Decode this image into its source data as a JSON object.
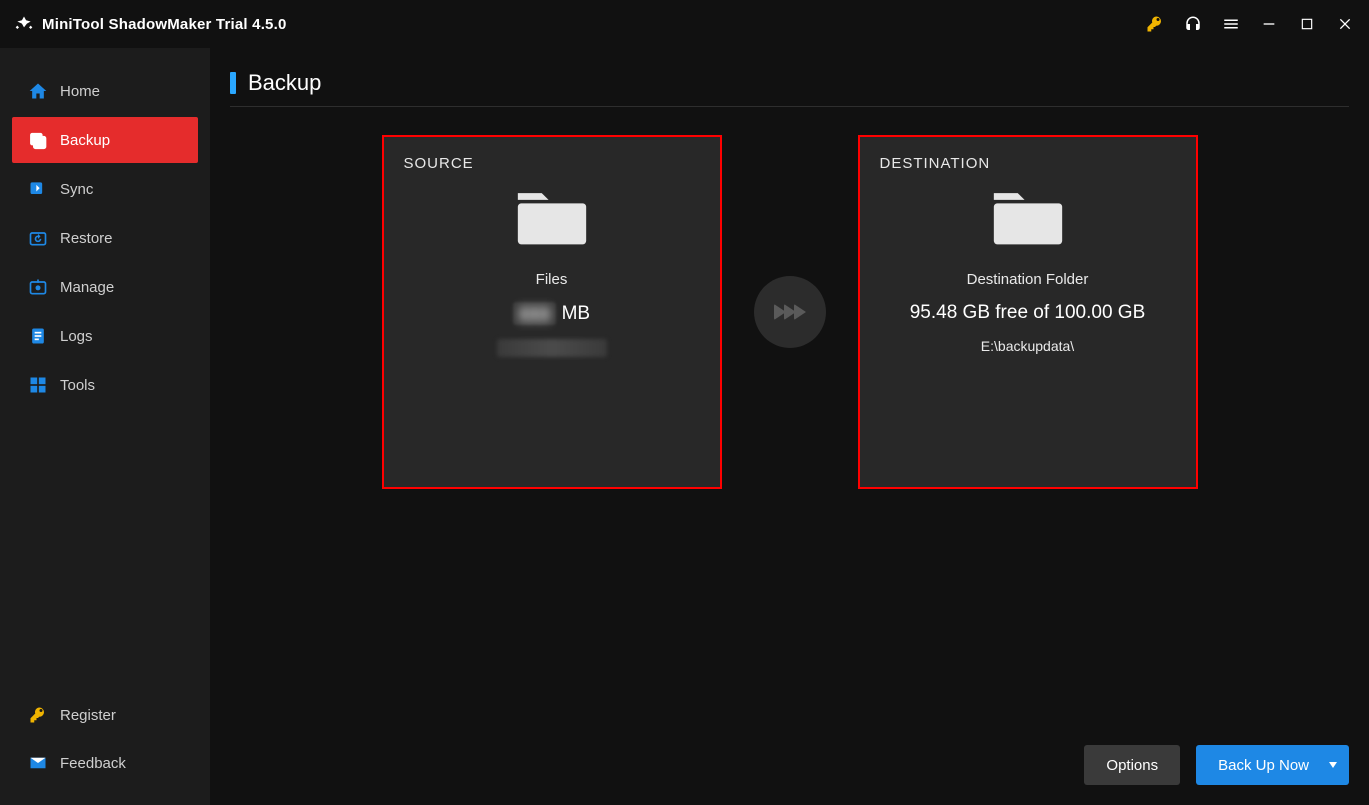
{
  "app": {
    "title": "MiniTool ShadowMaker Trial 4.5.0"
  },
  "titlebar_icons": {
    "key": "key-icon",
    "headset": "headset-icon",
    "menu": "menu-icon",
    "minimize": "minimize-icon",
    "maximize": "maximize-icon",
    "close": "close-icon"
  },
  "sidebar": {
    "items": [
      {
        "id": "home",
        "label": "Home",
        "icon": "home-icon",
        "active": false
      },
      {
        "id": "backup",
        "label": "Backup",
        "icon": "backup-icon",
        "active": true
      },
      {
        "id": "sync",
        "label": "Sync",
        "icon": "sync-icon",
        "active": false
      },
      {
        "id": "restore",
        "label": "Restore",
        "icon": "restore-icon",
        "active": false
      },
      {
        "id": "manage",
        "label": "Manage",
        "icon": "manage-icon",
        "active": false
      },
      {
        "id": "logs",
        "label": "Logs",
        "icon": "logs-icon",
        "active": false
      },
      {
        "id": "tools",
        "label": "Tools",
        "icon": "tools-icon",
        "active": false
      }
    ],
    "bottom": [
      {
        "id": "register",
        "label": "Register",
        "icon": "register-icon"
      },
      {
        "id": "feedback",
        "label": "Feedback",
        "icon": "feedback-icon"
      }
    ]
  },
  "page": {
    "title": "Backup"
  },
  "source": {
    "heading": "SOURCE",
    "type_label": "Files",
    "size_unit": "MB",
    "size_value_obscured": "▮▮▮",
    "path_obscured": "▮▮▮▮▮▮▮▮▮▮"
  },
  "destination": {
    "heading": "DESTINATION",
    "folder_label": "Destination Folder",
    "space_text": "95.48 GB free of 100.00 GB",
    "path": "E:\\backupdata\\"
  },
  "buttons": {
    "options": "Options",
    "backup_now": "Back Up Now"
  },
  "colors": {
    "accent_red": "#e52c2c",
    "primary_blue": "#1e88e5",
    "header_blue": "#2aa7ff",
    "card_border": "#ff0000",
    "key_icon": "#f0b400"
  }
}
